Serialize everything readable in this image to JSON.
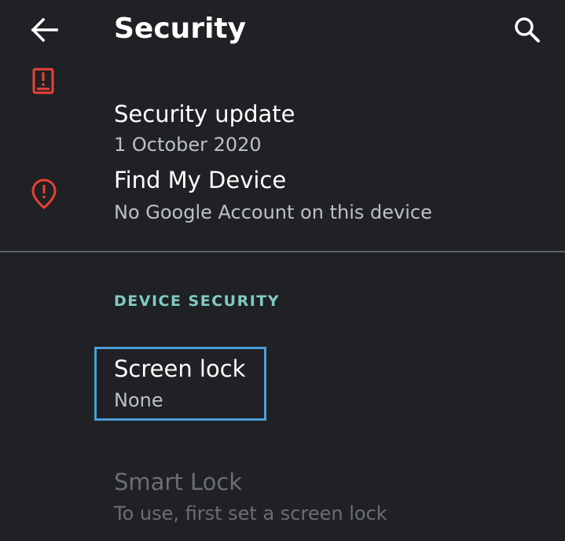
{
  "app_bar": {
    "title": "Security",
    "back_icon": "arrow-back-icon",
    "search_icon": "search-icon"
  },
  "items": {
    "security_update": {
      "title": "Security update",
      "subtitle": "1 October 2020",
      "icon": "security-update-warning-icon",
      "icon_color": "#ea4335"
    },
    "find_my_device": {
      "title": "Find My Device",
      "subtitle": "No Google Account on this device",
      "icon": "location-alert-icon",
      "icon_color": "#ea4335"
    }
  },
  "device_security": {
    "header": "DEVICE SECURITY",
    "header_color": "#80cbc4",
    "screen_lock": {
      "title": "Screen lock",
      "subtitle": "None"
    },
    "smart_lock": {
      "title": "Smart Lock",
      "subtitle": "To use, first set a screen lock",
      "enabled": false
    }
  },
  "colors": {
    "background": "#202124",
    "focus_outline": "#4a9fd8",
    "divider": "#5f6368"
  }
}
